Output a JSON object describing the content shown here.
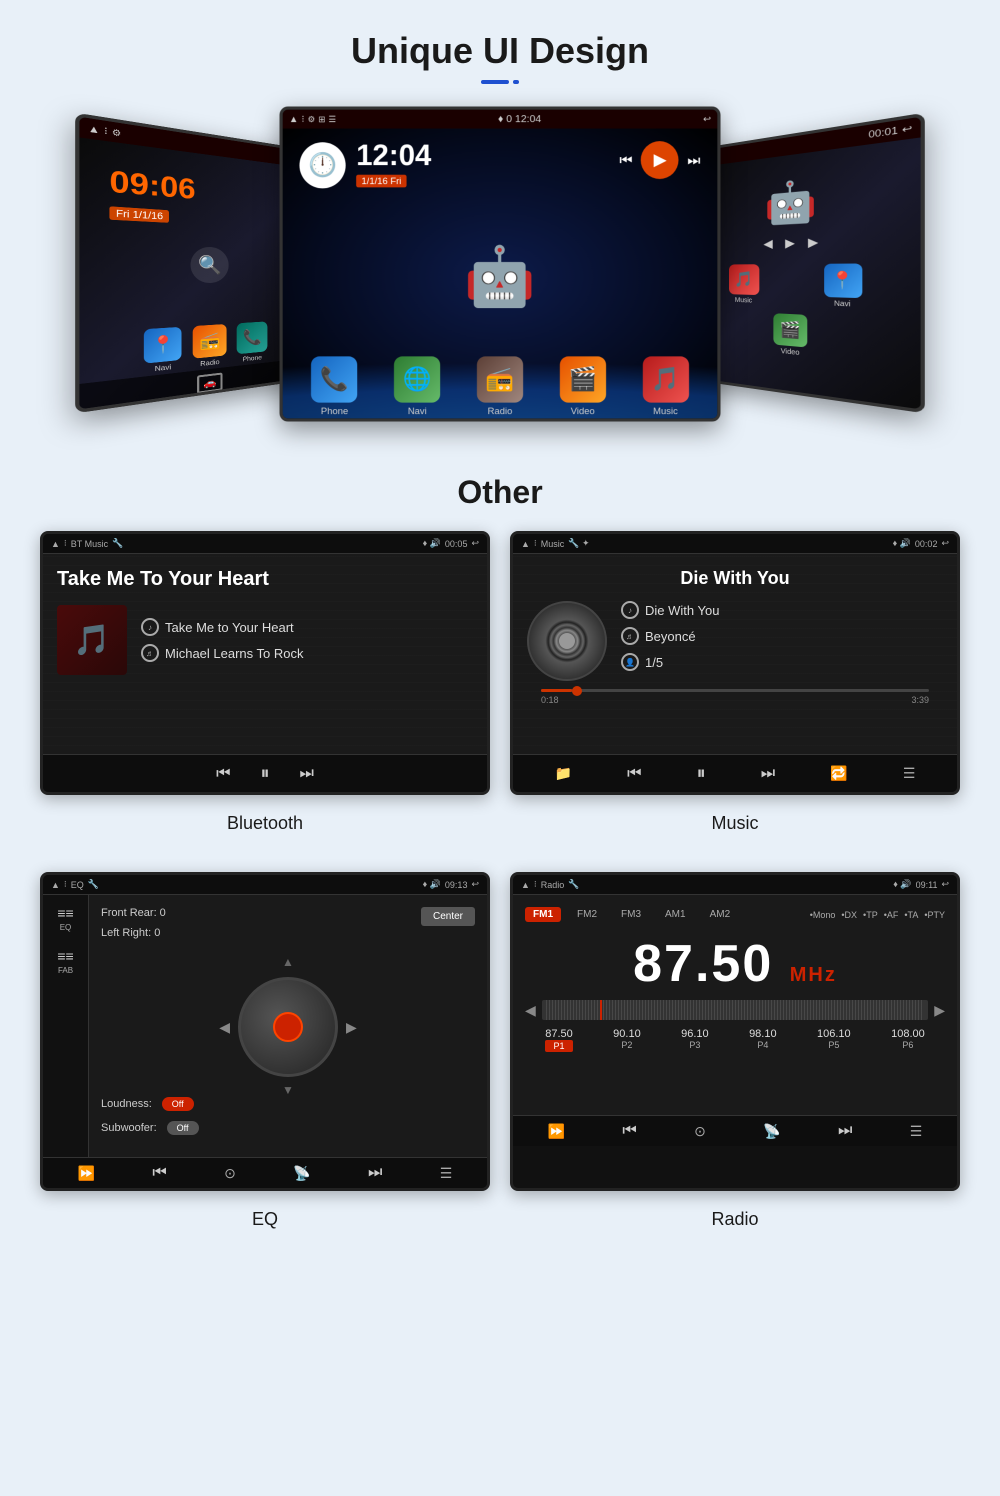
{
  "page": {
    "bg_color": "#e8f0f8"
  },
  "section1": {
    "title": "Unique UI Design",
    "underline": "—•"
  },
  "left_screen": {
    "time": "09:06",
    "date": "Fri 1/1/16",
    "apps": [
      "Navi",
      "Radio",
      "Phone"
    ]
  },
  "center_screen": {
    "time": "12:04",
    "date": "1/1/16 Fri",
    "apps": [
      "Phone",
      "Navi",
      "Radio",
      "Video",
      "Music"
    ]
  },
  "right_screen": {
    "apps": [
      "Music",
      "Navi",
      "Video"
    ]
  },
  "section2": {
    "title": "Other"
  },
  "bt_screen": {
    "status_left": "▲  ⁝  BT Music 🔧",
    "status_right": "♦ 🔊  00:05  ↩",
    "title": "Take Me To Your Heart",
    "track": "Take Me to Your Heart",
    "artist": "Michael Learns To Rock",
    "caption": "Bluetooth"
  },
  "music_screen": {
    "status_left": "▲  ⁝  Music 🔧 ✦",
    "status_right": "♦ 🔊  00:02  ↩",
    "title": "Die With You",
    "track": "Die With You",
    "artist": "Beyoncé",
    "track_num": "1/5",
    "time_current": "0:18",
    "time_total": "3:39",
    "caption": "Music"
  },
  "eq_screen": {
    "status_left": "▲  ⁝  EQ 🔧",
    "status_right": "♦ 🔊  09:13  ↩",
    "front_rear": "Front Rear:  0",
    "left_right": "Left Right:  0",
    "loudness": "Loudness:",
    "loudness_state": "Off",
    "subwoofer": "Subwoofer:",
    "subwoofer_state": "Off",
    "center_label": "Center",
    "sidebar_items": [
      {
        "icon": "≡≡",
        "label": "EQ"
      },
      {
        "icon": "≡≡",
        "label": "FAB"
      }
    ],
    "caption": "EQ"
  },
  "radio_screen": {
    "status_left": "▲  ⁝  Radio 🔧",
    "status_right": "♦ 🔊  09:11  ↩",
    "bands": [
      "FM1",
      "FM2",
      "FM3",
      "AM1",
      "AM2"
    ],
    "active_band": "FM1",
    "options": [
      "Mono",
      "DX",
      "TP",
      "AF",
      "TA",
      "PTY"
    ],
    "frequency": "87.50",
    "unit": "MHz",
    "presets": [
      {
        "freq": "87.50",
        "label": "P1",
        "active": true
      },
      {
        "freq": "90.10",
        "label": "P2",
        "active": false
      },
      {
        "freq": "96.10",
        "label": "P3",
        "active": false
      },
      {
        "freq": "98.10",
        "label": "P4",
        "active": false
      },
      {
        "freq": "106.10",
        "label": "P5",
        "active": false
      },
      {
        "freq": "108.00",
        "label": "P6",
        "active": false
      }
    ],
    "caption": "Radio"
  },
  "controls": {
    "prev": "⏮",
    "play": "▶",
    "pause": "⏸",
    "next": "⏭",
    "rewind": "◀◀",
    "forward": "▶▶",
    "repeat": "🔁",
    "playlist": "☰",
    "folder": "📁"
  }
}
